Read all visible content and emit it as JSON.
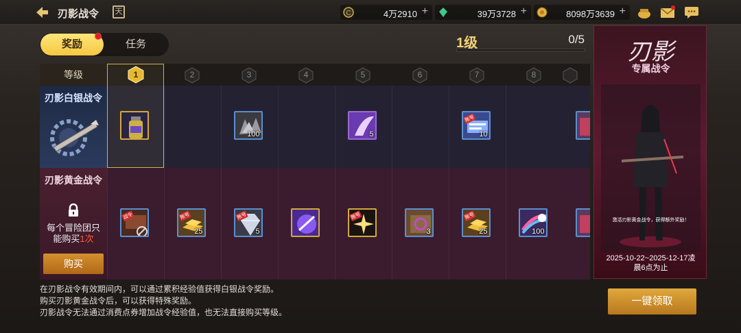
{
  "header": {
    "title": "刃影战令",
    "calendar_glyph": "天",
    "currencies": [
      {
        "icon": "coin-c-icon",
        "value": "4万2910",
        "color": "#c9b25a"
      },
      {
        "icon": "gem-icon",
        "value": "39万3728",
        "color": "#3ec88a"
      },
      {
        "icon": "gold-coin-icon",
        "value": "8098万3639",
        "color": "#e0b040"
      }
    ]
  },
  "tabs": {
    "reward": "奖励",
    "task": "任务"
  },
  "level": {
    "label": "1级",
    "progress": "0/5",
    "fraction": 0
  },
  "grid": {
    "header_label": "等级",
    "levels": [
      "1",
      "2",
      "3",
      "4",
      "5",
      "6",
      "7",
      "8"
    ],
    "silver": {
      "title": "刃影白银战令"
    },
    "gold": {
      "title": "刃影黄金战令",
      "note_prefix": "每个冒险团只能购买",
      "note_highlight": "1次",
      "buy_label": "购买"
    },
    "silver_items": [
      {
        "col": 0,
        "icon": "potion-bottle-icon",
        "count": ""
      },
      {
        "col": 2,
        "icon": "crystal-pile-icon",
        "count": "100"
      },
      {
        "col": 4,
        "icon": "purple-wing-icon",
        "count": "5"
      },
      {
        "col": 6,
        "icon": "ticket-icon",
        "count": "10",
        "tag": "账号"
      },
      {
        "col": 8,
        "icon": "partial-item-icon",
        "count": ""
      }
    ],
    "gold_items": [
      {
        "col": 0,
        "icon": "token-locked-icon",
        "count": "",
        "tag": "战令"
      },
      {
        "col": 1,
        "icon": "gold-bars-icon",
        "count": "25",
        "tag": "账号"
      },
      {
        "col": 2,
        "icon": "diamond-icon",
        "count": "5",
        "tag": "账号"
      },
      {
        "col": 3,
        "icon": "purple-spark-icon",
        "count": ""
      },
      {
        "col": 4,
        "icon": "gold-sparkle-icon",
        "count": "",
        "tag": "账号"
      },
      {
        "col": 5,
        "icon": "ring-box-icon",
        "count": "3"
      },
      {
        "col": 6,
        "icon": "gold-bars-icon",
        "count": "25",
        "tag": "账号"
      },
      {
        "col": 7,
        "icon": "rainbow-scroll-icon",
        "count": "100"
      },
      {
        "col": 8,
        "icon": "partial-item-icon",
        "count": ""
      }
    ]
  },
  "banner": {
    "title": "刃影",
    "subtitle": "专属战令",
    "note": "激活刃影黄金战令，获得额外奖励！",
    "date_line1": "2025-10-22~2025-12-17凌",
    "date_line2": "晨6点为止"
  },
  "description": [
    "在刃影战令有效期间内，可以通过累积经验值获得白银战令奖励。",
    "购买刃影黄金战令后，可以获得特殊奖励。",
    "刃影战令无法通过消费点券增加战令经验值，也无法直接购买等级。"
  ],
  "claim_button": "一键领取"
}
